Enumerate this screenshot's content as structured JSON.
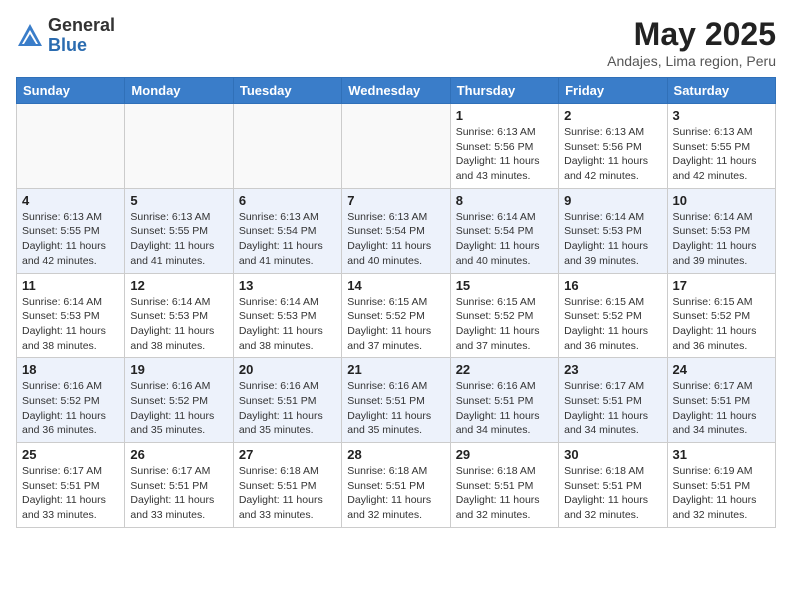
{
  "header": {
    "logo_general": "General",
    "logo_blue": "Blue",
    "month": "May 2025",
    "location": "Andajes, Lima region, Peru"
  },
  "days_of_week": [
    "Sunday",
    "Monday",
    "Tuesday",
    "Wednesday",
    "Thursday",
    "Friday",
    "Saturday"
  ],
  "weeks": [
    [
      {
        "day": "",
        "info": ""
      },
      {
        "day": "",
        "info": ""
      },
      {
        "day": "",
        "info": ""
      },
      {
        "day": "",
        "info": ""
      },
      {
        "day": "1",
        "info": "Sunrise: 6:13 AM\nSunset: 5:56 PM\nDaylight: 11 hours and 43 minutes."
      },
      {
        "day": "2",
        "info": "Sunrise: 6:13 AM\nSunset: 5:56 PM\nDaylight: 11 hours and 42 minutes."
      },
      {
        "day": "3",
        "info": "Sunrise: 6:13 AM\nSunset: 5:55 PM\nDaylight: 11 hours and 42 minutes."
      }
    ],
    [
      {
        "day": "4",
        "info": "Sunrise: 6:13 AM\nSunset: 5:55 PM\nDaylight: 11 hours and 42 minutes."
      },
      {
        "day": "5",
        "info": "Sunrise: 6:13 AM\nSunset: 5:55 PM\nDaylight: 11 hours and 41 minutes."
      },
      {
        "day": "6",
        "info": "Sunrise: 6:13 AM\nSunset: 5:54 PM\nDaylight: 11 hours and 41 minutes."
      },
      {
        "day": "7",
        "info": "Sunrise: 6:13 AM\nSunset: 5:54 PM\nDaylight: 11 hours and 40 minutes."
      },
      {
        "day": "8",
        "info": "Sunrise: 6:14 AM\nSunset: 5:54 PM\nDaylight: 11 hours and 40 minutes."
      },
      {
        "day": "9",
        "info": "Sunrise: 6:14 AM\nSunset: 5:53 PM\nDaylight: 11 hours and 39 minutes."
      },
      {
        "day": "10",
        "info": "Sunrise: 6:14 AM\nSunset: 5:53 PM\nDaylight: 11 hours and 39 minutes."
      }
    ],
    [
      {
        "day": "11",
        "info": "Sunrise: 6:14 AM\nSunset: 5:53 PM\nDaylight: 11 hours and 38 minutes."
      },
      {
        "day": "12",
        "info": "Sunrise: 6:14 AM\nSunset: 5:53 PM\nDaylight: 11 hours and 38 minutes."
      },
      {
        "day": "13",
        "info": "Sunrise: 6:14 AM\nSunset: 5:53 PM\nDaylight: 11 hours and 38 minutes."
      },
      {
        "day": "14",
        "info": "Sunrise: 6:15 AM\nSunset: 5:52 PM\nDaylight: 11 hours and 37 minutes."
      },
      {
        "day": "15",
        "info": "Sunrise: 6:15 AM\nSunset: 5:52 PM\nDaylight: 11 hours and 37 minutes."
      },
      {
        "day": "16",
        "info": "Sunrise: 6:15 AM\nSunset: 5:52 PM\nDaylight: 11 hours and 36 minutes."
      },
      {
        "day": "17",
        "info": "Sunrise: 6:15 AM\nSunset: 5:52 PM\nDaylight: 11 hours and 36 minutes."
      }
    ],
    [
      {
        "day": "18",
        "info": "Sunrise: 6:16 AM\nSunset: 5:52 PM\nDaylight: 11 hours and 36 minutes."
      },
      {
        "day": "19",
        "info": "Sunrise: 6:16 AM\nSunset: 5:52 PM\nDaylight: 11 hours and 35 minutes."
      },
      {
        "day": "20",
        "info": "Sunrise: 6:16 AM\nSunset: 5:51 PM\nDaylight: 11 hours and 35 minutes."
      },
      {
        "day": "21",
        "info": "Sunrise: 6:16 AM\nSunset: 5:51 PM\nDaylight: 11 hours and 35 minutes."
      },
      {
        "day": "22",
        "info": "Sunrise: 6:16 AM\nSunset: 5:51 PM\nDaylight: 11 hours and 34 minutes."
      },
      {
        "day": "23",
        "info": "Sunrise: 6:17 AM\nSunset: 5:51 PM\nDaylight: 11 hours and 34 minutes."
      },
      {
        "day": "24",
        "info": "Sunrise: 6:17 AM\nSunset: 5:51 PM\nDaylight: 11 hours and 34 minutes."
      }
    ],
    [
      {
        "day": "25",
        "info": "Sunrise: 6:17 AM\nSunset: 5:51 PM\nDaylight: 11 hours and 33 minutes."
      },
      {
        "day": "26",
        "info": "Sunrise: 6:17 AM\nSunset: 5:51 PM\nDaylight: 11 hours and 33 minutes."
      },
      {
        "day": "27",
        "info": "Sunrise: 6:18 AM\nSunset: 5:51 PM\nDaylight: 11 hours and 33 minutes."
      },
      {
        "day": "28",
        "info": "Sunrise: 6:18 AM\nSunset: 5:51 PM\nDaylight: 11 hours and 32 minutes."
      },
      {
        "day": "29",
        "info": "Sunrise: 6:18 AM\nSunset: 5:51 PM\nDaylight: 11 hours and 32 minutes."
      },
      {
        "day": "30",
        "info": "Sunrise: 6:18 AM\nSunset: 5:51 PM\nDaylight: 11 hours and 32 minutes."
      },
      {
        "day": "31",
        "info": "Sunrise: 6:19 AM\nSunset: 5:51 PM\nDaylight: 11 hours and 32 minutes."
      }
    ]
  ]
}
